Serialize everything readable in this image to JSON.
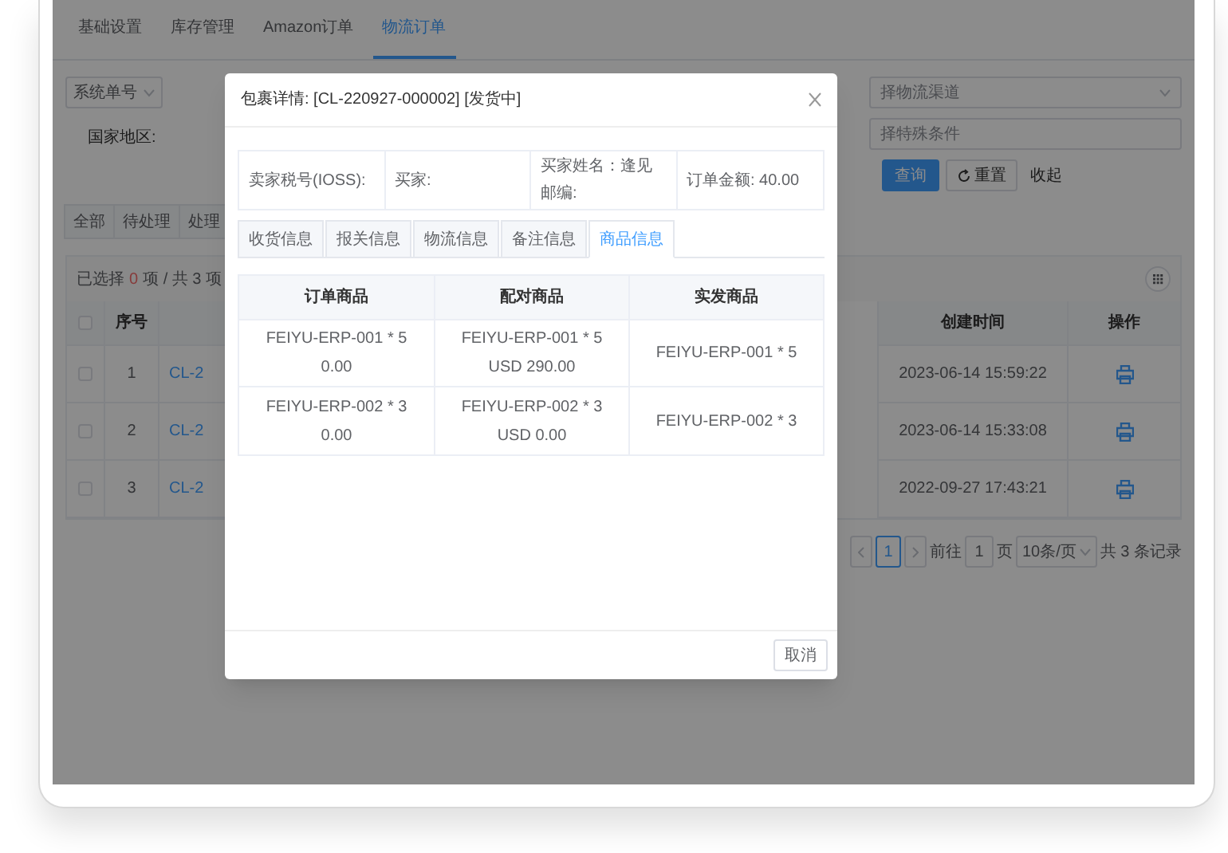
{
  "nav_tabs": [
    {
      "label": "基础设置",
      "selected": false
    },
    {
      "label": "库存管理",
      "selected": false
    },
    {
      "label": "Amazon订单",
      "selected": false
    },
    {
      "label": "物流订单",
      "selected": true
    }
  ],
  "filters": {
    "system_no_select": "系统单号",
    "country_label": "国家地区:",
    "channel_placeholder": "择物流渠道",
    "condition_placeholder": "择特殊条件",
    "buttons": [
      {
        "kind": "primary",
        "label": "查询"
      },
      {
        "kind": "reset",
        "label": "重置"
      },
      {
        "kind": "link",
        "label": "收起"
      }
    ]
  },
  "status_tabs": [
    {
      "label": "全部",
      "selected": false
    },
    {
      "label": "待处理",
      "selected": false
    },
    {
      "label": "处理",
      "selected": false
    }
  ],
  "table": {
    "all_checked": false,
    "selected_label": "已选择",
    "selected_count": "0",
    "total_text": "项 / 共 3 项",
    "columns": [
      "序号",
      "创建时间",
      "操作"
    ],
    "rows": [
      {
        "checked": false,
        "index": "1",
        "order_no": "CL-2",
        "created": "2023-06-14 15:59:22"
      },
      {
        "checked": false,
        "index": "2",
        "order_no": "CL-2",
        "created": "2023-06-14 15:33:08"
      },
      {
        "checked": false,
        "index": "3",
        "order_no": "CL-2",
        "created": "2022-09-27 17:43:21"
      }
    ]
  },
  "pagination": {
    "pages": [
      {
        "label": "1",
        "selected": true
      }
    ],
    "goto_label": "前往",
    "goto_value": "1",
    "page_unit": "页",
    "page_size": "10条/页",
    "total": "共 3 条记录"
  },
  "modal": {
    "title": "包裹详情: [CL-220927-000002] [发货中]",
    "info": [
      {
        "lines": [
          "卖家税号(IOSS):"
        ]
      },
      {
        "lines": [
          "买家:"
        ]
      },
      {
        "lines": [
          "买家姓名：逢见",
          "邮编:"
        ]
      },
      {
        "lines": [
          "订单金额:  40.00"
        ]
      }
    ],
    "tabs": [
      {
        "label": "收货信息",
        "selected": false
      },
      {
        "label": "报关信息",
        "selected": false
      },
      {
        "label": "物流信息",
        "selected": false
      },
      {
        "label": "备注信息",
        "selected": false
      },
      {
        "label": "商品信息",
        "selected": true
      }
    ],
    "columns": [
      "订单商品",
      "配对商品",
      "实发商品"
    ],
    "rows": [
      [
        [
          "FEIYU-ERP-001 * 5",
          "0.00"
        ],
        [
          "FEIYU-ERP-001 * 5",
          "USD 290.00"
        ],
        [
          "FEIYU-ERP-001 * 5"
        ]
      ],
      [
        [
          "FEIYU-ERP-002 * 3",
          "0.00"
        ],
        [
          "FEIYU-ERP-002 * 3",
          "USD 0.00"
        ],
        [
          "FEIYU-ERP-002 * 3"
        ]
      ]
    ],
    "footer_buttons": [
      "取消"
    ]
  }
}
